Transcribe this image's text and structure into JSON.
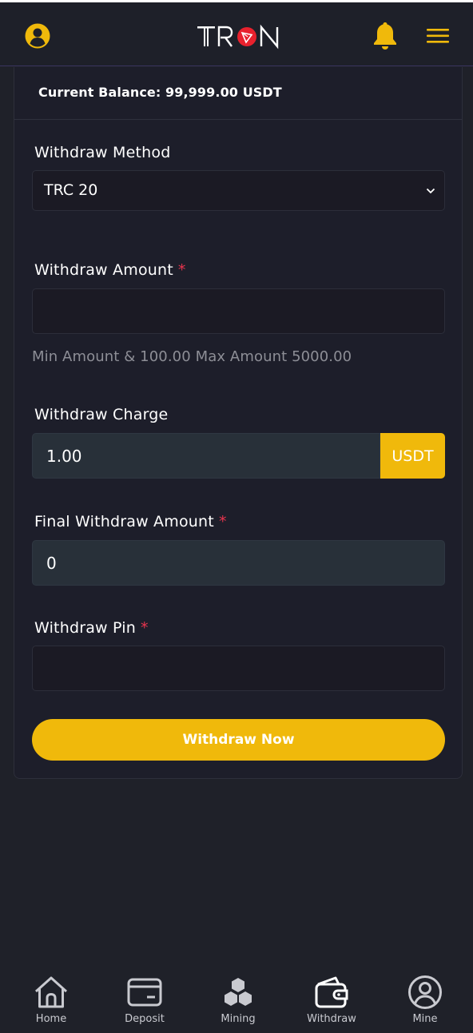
{
  "header": {
    "logo_text": "TRON",
    "avatar_icon": "user-circle-icon",
    "bell_icon": "bell-icon",
    "menu_icon": "hamburger-menu-icon"
  },
  "balance": {
    "text": "Current Balance: 99,999.00 USDT"
  },
  "form": {
    "method_label": "Withdraw Method",
    "method_value": "TRC 20",
    "amount_label": "Withdraw Amount",
    "amount_value": "",
    "amount_hint": "Min Amount & 100.00 Max Amount 5000.00",
    "charge_label": "Withdraw Charge",
    "charge_value": "1.00",
    "charge_unit": "USDT",
    "final_label": "Final Withdraw Amount",
    "final_value": "0",
    "pin_label": "Withdraw Pin",
    "pin_value": "",
    "required_mark": "*",
    "submit_label": "Withdraw Now"
  },
  "nav": {
    "items": [
      {
        "label": "Home",
        "icon": "home-icon"
      },
      {
        "label": "Deposit",
        "icon": "card-icon"
      },
      {
        "label": "Mining",
        "icon": "cubes-icon"
      },
      {
        "label": "Withdraw",
        "icon": "wallet-icon"
      },
      {
        "label": "Mine",
        "icon": "profile-icon"
      }
    ]
  },
  "colors": {
    "accent": "#f0b90b",
    "background": "#1f2129",
    "required": "#e8344e",
    "logo_red": "#e8212d"
  }
}
